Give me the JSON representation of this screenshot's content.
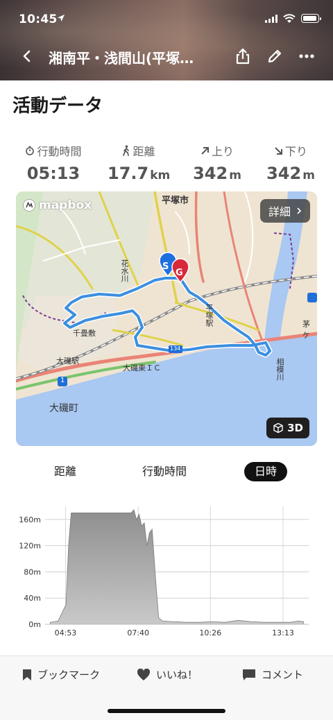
{
  "status_bar": {
    "time": "10:45"
  },
  "nav": {
    "title": "湘南平・浅間山(平塚…"
  },
  "section_title": "活動データ",
  "stats": [
    {
      "label": "行動時間",
      "value": "05:13",
      "unit": ""
    },
    {
      "label": "距離",
      "value": "17.7",
      "unit": "km"
    },
    {
      "label": "上り",
      "value": "342",
      "unit": "m"
    },
    {
      "label": "下り",
      "value": "342",
      "unit": "m"
    }
  ],
  "map": {
    "logo_text": "mapbox",
    "detail_label": "詳細",
    "btn_3d_label": "3D",
    "start_marker": "S",
    "goal_marker": "G",
    "labels": {
      "hiratsuka_city": "平塚市",
      "hanamizu_river": "花水川",
      "hiratsuka_station": "平塚駅",
      "chigasaki": "千畳敷",
      "oiso_station": "大磯駅",
      "oiso_ic": "大磯東ＩＣ",
      "oiso_town": "大磯町",
      "sagami_river": "相模川",
      "route_1": "1",
      "route_134": "134",
      "route_top": "茅ケ",
      "kanagawa": "茅ケ"
    },
    "colors": {
      "route": "#3b8fe0",
      "sea": "#a9c8f2",
      "start": "#1e6fe0",
      "goal": "#d9283a"
    }
  },
  "tabs": [
    {
      "label": "距離",
      "active": false
    },
    {
      "label": "行動時間",
      "active": false
    },
    {
      "label": "日時",
      "active": true
    }
  ],
  "chart_data": {
    "type": "area",
    "x_ticks": [
      "04:53",
      "07:40",
      "10:26",
      "13:13"
    ],
    "y_ticks": [
      "0m",
      "40m",
      "80m",
      "120m",
      "160m"
    ],
    "ylim": [
      0,
      180
    ],
    "x_hours": [
      4.3,
      4.6,
      4.9,
      5.0,
      5.1,
      5.5,
      6.0,
      6.5,
      7.0,
      7.4,
      7.5,
      7.6,
      7.7,
      7.8,
      7.9,
      8.0,
      8.1,
      8.2,
      8.35,
      8.45,
      8.6,
      9.0,
      9.5,
      10.0,
      10.5,
      11.0,
      11.5,
      12.0,
      12.5,
      13.0,
      13.5,
      13.8,
      14.0
    ],
    "y_m": [
      3,
      5,
      30,
      120,
      170,
      170,
      170,
      170,
      170,
      170,
      175,
      160,
      168,
      150,
      155,
      120,
      140,
      145,
      60,
      10,
      5,
      4,
      3,
      3,
      4,
      3,
      6,
      4,
      3,
      3,
      3,
      5,
      4
    ]
  },
  "bottom_bar": {
    "bookmark": "ブックマーク",
    "like": "いいね！",
    "comment": "コメント"
  }
}
